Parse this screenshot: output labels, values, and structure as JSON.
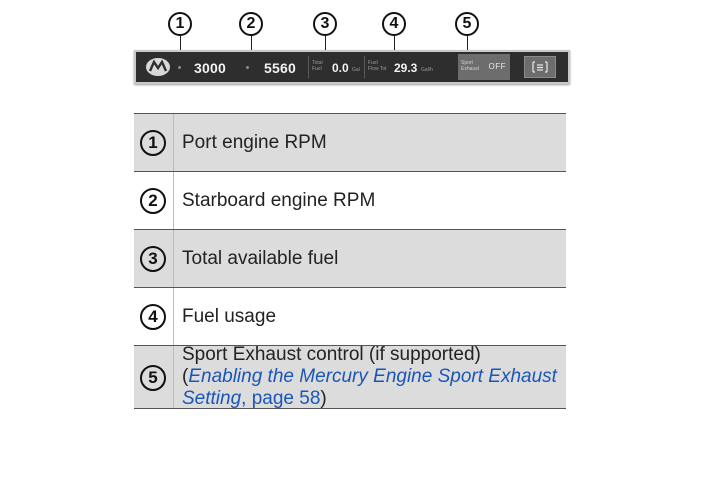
{
  "figure": {
    "callouts": [
      "1",
      "2",
      "3",
      "4",
      "5"
    ],
    "gauges": {
      "port_rpm": "3000",
      "starboard_rpm": "5560",
      "total_fuel_label_1": "Total",
      "total_fuel_label_2": "Fuel",
      "total_fuel_value": "0.0",
      "total_fuel_unit": "Gal",
      "fuel_rate_label_1": "Fuel",
      "fuel_rate_label_2": "Flow Tot",
      "fuel_rate_value": "29.3",
      "fuel_rate_unit": "Gal/h",
      "sport_label_1": "Sport",
      "sport_label_2": "Exhaust",
      "sport_state": "OFF",
      "menu_icon": "menu-icon"
    }
  },
  "legend": [
    {
      "number": "1",
      "text": "Port engine RPM"
    },
    {
      "number": "2",
      "text": "Starboard engine RPM"
    },
    {
      "number": "3",
      "text": "Total available fuel"
    },
    {
      "number": "4",
      "text": "Fuel usage"
    },
    {
      "number": "5",
      "text_before": "Sport Exhaust control (if supported) (",
      "link_text": "Enabling the Mercury Engine Sport Exhaust Setting",
      "page_text": ", page 58",
      "text_after": ")"
    }
  ],
  "colors": {
    "shaded_row": "#dcdcdc",
    "link": "#1a56b8",
    "gauge_background": "#2e2e2e"
  }
}
